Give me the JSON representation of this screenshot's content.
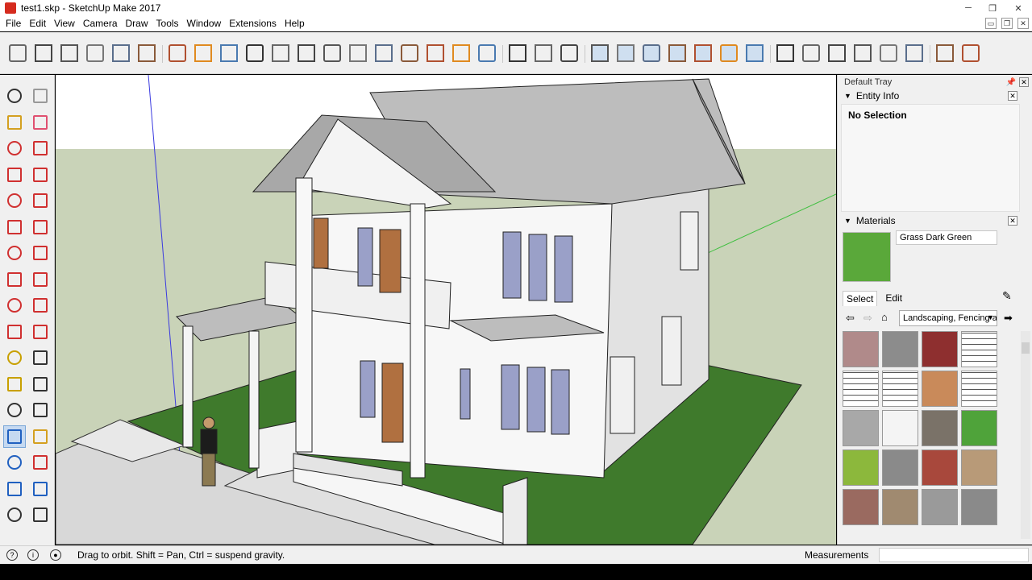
{
  "window": {
    "title": "test1.skp - SketchUp Make 2017",
    "minimize": "─",
    "restore": "❐",
    "close": "✕"
  },
  "menu": [
    "File",
    "Edit",
    "View",
    "Camera",
    "Draw",
    "Tools",
    "Window",
    "Extensions",
    "Help"
  ],
  "mdi": {
    "minimize": "▭",
    "restore": "❐",
    "close": "✕"
  },
  "toolbar_icons": [
    "iso-view-icon",
    "top-view-icon",
    "front-view-icon",
    "right-view-icon",
    "back-view-icon",
    "left-view-icon",
    "section-plane-icon",
    "dimensions-icon",
    "wall-icon",
    "column-icon",
    "window-icon",
    "door-icon",
    "beam-icon",
    "panel-icon",
    "stair-icon",
    "chair-icon",
    "stair-step-icon",
    "house-icon",
    "grid-icon",
    "push-pull-icon",
    "measure-tool-icon",
    "follow-me-icon",
    "xray-icon",
    "back-edges-icon",
    "wireframe-icon",
    "hidden-line-icon",
    "shaded-icon",
    "shaded-textures-icon",
    "monochrome-icon",
    "components-icon",
    "layers-icon",
    "scenes-icon",
    "styles-icon",
    "shadows-icon",
    "fog-icon",
    "extension-warehouse-icon",
    "3d-warehouse-icon"
  ],
  "left_tools": [
    "select-icon",
    "make-component-icon",
    "paint-bucket-icon",
    "eraser-icon",
    "line-icon",
    "freehand-icon",
    "rectangle-icon",
    "rotated-rectangle-icon",
    "circle-icon",
    "polygon-icon",
    "arc-icon",
    "pie-icon",
    "two-point-arc-icon",
    "three-point-arc-icon",
    "move-icon",
    "push-pull-tool-icon",
    "rotate-icon",
    "follow-me-tool-icon",
    "scale-icon",
    "offset-icon",
    "tape-measure-icon",
    "dimension-icon",
    "protractor-icon",
    "text-icon",
    "axes-icon",
    "3d-text-icon",
    "orbit-icon",
    "pan-icon",
    "zoom-icon",
    "zoom-window-icon",
    "zoom-extents-icon",
    "previous-view-icon",
    "position-camera-icon",
    "look-around-icon"
  ],
  "tray": {
    "title": "Default Tray",
    "pin": "📌",
    "close": "✕",
    "entity_info": {
      "label": "Entity Info",
      "selection": "No Selection",
      "close": "✕"
    },
    "materials": {
      "label": "Materials",
      "close": "✕",
      "material_name": "Grass Dark Green",
      "swatch_color": "#5aa83a",
      "tabs": [
        "Select",
        "Edit"
      ],
      "library": "Landscaping, Fencing a",
      "swatches": [
        "#b08a8a",
        "#8c8c8c",
        "#8e2f2f",
        "#ffffff",
        "#ffffff",
        "#ffffff",
        "#c98a5a",
        "#ffffff",
        "#a8a8a8",
        "#f4f4f4",
        "#7a7268",
        "#4fa33a",
        "#8cb83c",
        "#8a8a8a",
        "#a8483c",
        "#b89a78",
        "#9a6a60",
        "#a08a70",
        "#9a9a9a",
        "#8a8a8a"
      ]
    }
  },
  "status": {
    "hint": "Drag to orbit. Shift = Pan, Ctrl = suspend gravity.",
    "icon_geo": "?",
    "icon_info": "i",
    "icon_user": "●",
    "measurements_label": "Measurements",
    "measurements_value": ""
  }
}
